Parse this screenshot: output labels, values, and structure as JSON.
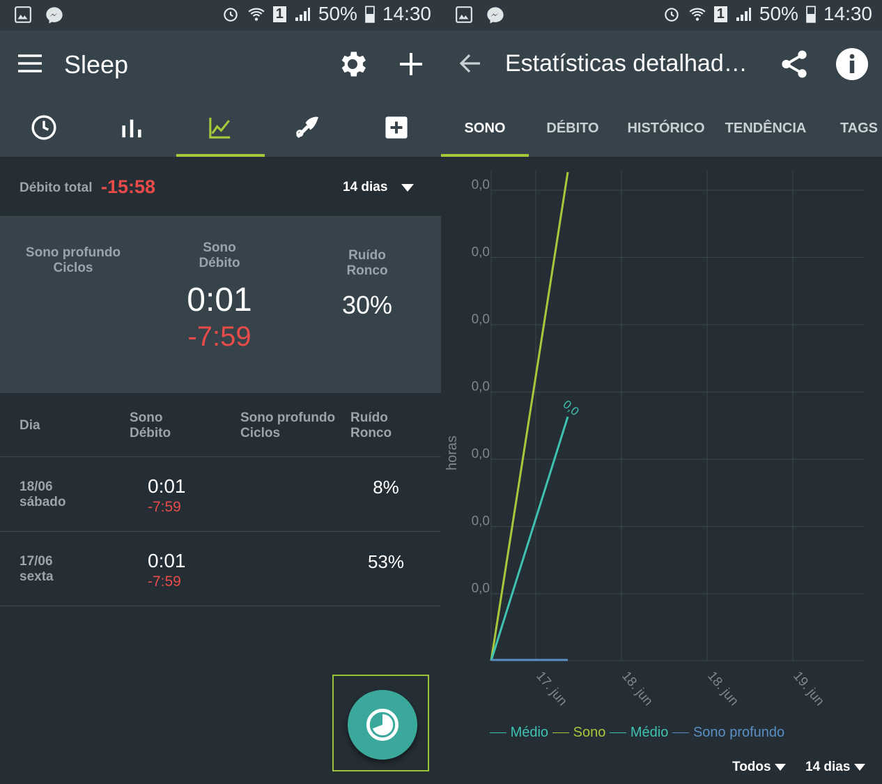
{
  "status_bar": {
    "battery": "50%",
    "time": "14:30",
    "sim": "1"
  },
  "left": {
    "app_title": "Sleep",
    "debit_label": "Débito total",
    "debit_value": "-15:58",
    "range": "14 dias",
    "summary": {
      "col1_line1": "Sono profundo",
      "col1_line2": "Ciclos",
      "col2_line1": "Sono",
      "col2_line2": "Débito",
      "col2_value": "0:01",
      "col2_debit": "-7:59",
      "col3_line1": "Ruído",
      "col3_line2": "Ronco",
      "col3_value": "30%"
    },
    "table_headers": {
      "dia": "Dia",
      "sono_1": "Sono",
      "sono_2": "Débito",
      "profundo_1": "Sono profundo",
      "profundo_2": "Ciclos",
      "ruido_1": "Ruído",
      "ruido_2": "Ronco"
    },
    "rows": [
      {
        "date": "18/06",
        "weekday": "sábado",
        "sleep": "0:01",
        "debit": "-7:59",
        "noise": "8%"
      },
      {
        "date": "17/06",
        "weekday": "sexta",
        "sleep": "0:01",
        "debit": "-7:59",
        "noise": "53%"
      }
    ]
  },
  "right": {
    "title": "Estatísticas detalhad…",
    "tabs": [
      "SONO",
      "DÉBITO",
      "HISTÓRICO",
      "TENDÊNCIA",
      "TAGS"
    ],
    "filter_all": "Todos",
    "filter_range": "14 dias"
  },
  "chart_data": {
    "type": "line",
    "ylabel": "horas",
    "y_tick_labels": [
      "0,0",
      "0,0",
      "0,0",
      "0,0",
      "0,0",
      "0,0",
      "0,0"
    ],
    "x_tick_labels": [
      "17. jun",
      "18. jun",
      "18. jun",
      "19. jun"
    ],
    "point_label": "0,0",
    "legend": [
      "Médio",
      "Sono",
      "Médio",
      "Sono profundo"
    ],
    "colors": {
      "sono": "#a7c83a",
      "medio": "#3ec2b1",
      "profundo": "#5a8fc4"
    }
  }
}
